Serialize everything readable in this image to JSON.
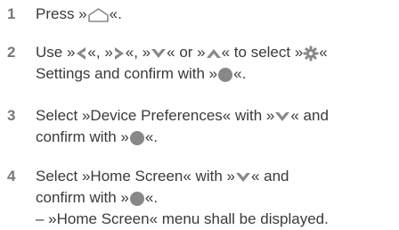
{
  "steps": [
    {
      "number": "1",
      "lines": [
        [
          "Press »",
          {
            "icon": "home-icon"
          },
          "«."
        ]
      ]
    },
    {
      "number": "2",
      "lines": [
        [
          "Use »",
          {
            "icon": "arrow-left-icon"
          },
          "«, »",
          {
            "icon": "arrow-right-icon"
          },
          "«, »",
          {
            "icon": "arrow-down-icon"
          },
          "« or »",
          {
            "icon": "arrow-up-icon"
          },
          "« to select »",
          {
            "icon": "gear-icon"
          },
          "«"
        ],
        [
          "Settings and confirm with »",
          {
            "icon": "ok-button-icon"
          },
          "«."
        ]
      ]
    },
    {
      "number": "3",
      "lines": [
        [
          "Select »Device Preferences« with »",
          {
            "icon": "arrow-down-icon"
          },
          "« and"
        ],
        [
          "confirm with »",
          {
            "icon": "ok-button-icon"
          },
          "«."
        ]
      ]
    },
    {
      "number": "4",
      "lines": [
        [
          "Select »Home Screen« with »",
          {
            "icon": "arrow-down-icon"
          },
          "« and"
        ],
        [
          "confirm with »",
          {
            "icon": "ok-button-icon"
          },
          "«."
        ]
      ],
      "result": "– »Home Screen« menu shall be displayed."
    }
  ],
  "colors": {
    "text": "#3a3a3a",
    "number": "#777777",
    "icon": "#888888"
  }
}
